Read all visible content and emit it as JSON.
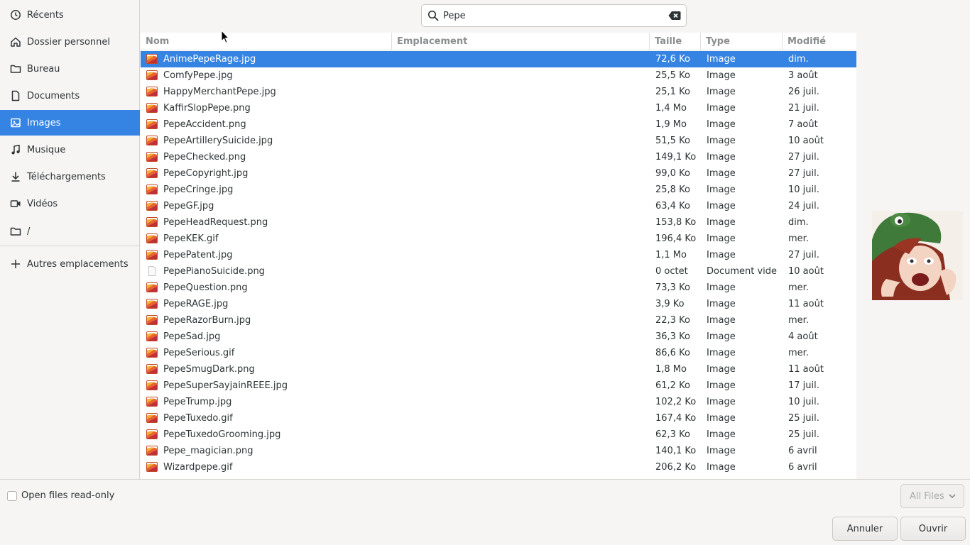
{
  "sidebar": {
    "items": [
      {
        "label": "Récents",
        "icon": "clock-icon"
      },
      {
        "label": "Dossier personnel",
        "icon": "home-icon"
      },
      {
        "label": "Bureau",
        "icon": "folder-icon"
      },
      {
        "label": "Documents",
        "icon": "document-icon"
      },
      {
        "label": "Images",
        "icon": "image-icon",
        "active": true
      },
      {
        "label": "Musique",
        "icon": "music-icon"
      },
      {
        "label": "Téléchargements",
        "icon": "download-icon"
      },
      {
        "label": "Vidéos",
        "icon": "video-icon"
      },
      {
        "label": "/",
        "icon": "folder-icon"
      },
      {
        "label": "Autres emplacements",
        "icon": "plus-icon"
      }
    ]
  },
  "search": {
    "value": "Pepe"
  },
  "columns": {
    "name": "Nom",
    "location": "Emplacement",
    "size": "Taille",
    "type": "Type",
    "modified": "Modifié"
  },
  "files": [
    {
      "name": "AnimePepeRage.jpg",
      "size": "72,6 Ko",
      "type": "Image",
      "modified": "dim.",
      "selected": true
    },
    {
      "name": "ComfyPepe.jpg",
      "size": "25,5 Ko",
      "type": "Image",
      "modified": "3 août"
    },
    {
      "name": "HappyMerchantPepe.jpg",
      "size": "25,1 Ko",
      "type": "Image",
      "modified": "26 juil."
    },
    {
      "name": "KaffirSlopPepe.png",
      "size": "1,4 Mo",
      "type": "Image",
      "modified": "21 juil."
    },
    {
      "name": "PepeAccident.png",
      "size": "1,9 Mo",
      "type": "Image",
      "modified": "7 août"
    },
    {
      "name": "PepeArtillerySuicide.jpg",
      "size": "51,5 Ko",
      "type": "Image",
      "modified": "10 août"
    },
    {
      "name": "PepeChecked.png",
      "size": "149,1 Ko",
      "type": "Image",
      "modified": "27 juil."
    },
    {
      "name": "PepeCopyright.jpg",
      "size": "99,0 Ko",
      "type": "Image",
      "modified": "27 juil."
    },
    {
      "name": "PepeCringe.jpg",
      "size": "25,8 Ko",
      "type": "Image",
      "modified": "10 juil."
    },
    {
      "name": "PepeGF.jpg",
      "size": "63,4 Ko",
      "type": "Image",
      "modified": "24 juil."
    },
    {
      "name": "PepeHeadRequest.png",
      "size": "153,8 Ko",
      "type": "Image",
      "modified": "dim."
    },
    {
      "name": "PepeKEK.gif",
      "size": "196,4 Ko",
      "type": "Image",
      "modified": "mer."
    },
    {
      "name": "PepePatent.jpg",
      "size": "1,1 Mo",
      "type": "Image",
      "modified": "27 juil."
    },
    {
      "name": "PepePianoSuicide.png",
      "size": "0 octet",
      "type": "Document vide",
      "modified": "10 août",
      "blank": true
    },
    {
      "name": "PepeQuestion.png",
      "size": "73,3 Ko",
      "type": "Image",
      "modified": "mer."
    },
    {
      "name": "PepeRAGE.jpg",
      "size": "3,9 Ko",
      "type": "Image",
      "modified": "11 août"
    },
    {
      "name": "PepeRazorBurn.jpg",
      "size": "22,3 Ko",
      "type": "Image",
      "modified": "mer."
    },
    {
      "name": "PepeSad.jpg",
      "size": "36,3 Ko",
      "type": "Image",
      "modified": "4 août"
    },
    {
      "name": "PepeSerious.gif",
      "size": "86,6 Ko",
      "type": "Image",
      "modified": "mer."
    },
    {
      "name": "PepeSmugDark.png",
      "size": "1,8 Mo",
      "type": "Image",
      "modified": "11 août"
    },
    {
      "name": "PepeSuperSayjainREEE.jpg",
      "size": "61,2 Ko",
      "type": "Image",
      "modified": "17 juil."
    },
    {
      "name": "PepeTrump.jpg",
      "size": "102,2 Ko",
      "type": "Image",
      "modified": "10 juil."
    },
    {
      "name": "PepeTuxedo.gif",
      "size": "167,4 Ko",
      "type": "Image",
      "modified": "25 juil."
    },
    {
      "name": "PepeTuxedoGrooming.jpg",
      "size": "62,3 Ko",
      "type": "Image",
      "modified": "25 juil."
    },
    {
      "name": "Pepe_magician.png",
      "size": "140,1 Ko",
      "type": "Image",
      "modified": "6 avril"
    },
    {
      "name": "Wizardpepe.gif",
      "size": "206,2 Ko",
      "type": "Image",
      "modified": "6 avril"
    }
  ],
  "bottom": {
    "readonly_label": "Open files read-only",
    "filter_label": "All Files",
    "cancel_label": "Annuler",
    "open_label": "Ouvrir"
  },
  "colors": {
    "accent": "#3584e4",
    "sidebar_bg": "#f6f5f4"
  }
}
